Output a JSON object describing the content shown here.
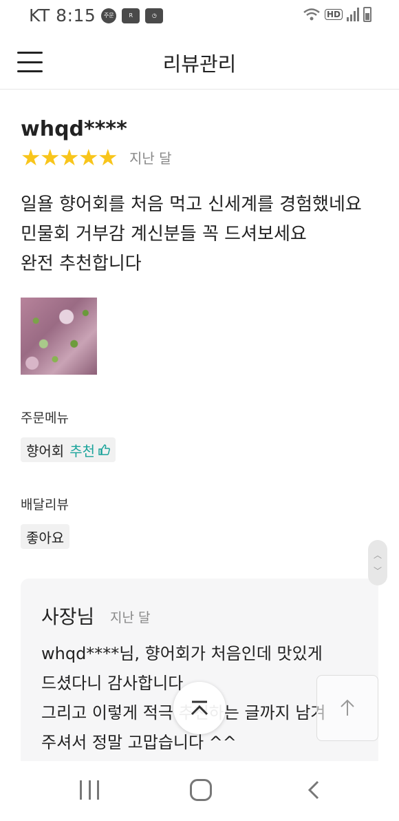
{
  "status_bar": {
    "carrier_time": "KT 8:15",
    "order_badge": "주문",
    "icon_r": "R",
    "hd_label": "HD"
  },
  "header": {
    "title": "리뷰관리"
  },
  "review": {
    "author": "whqd****",
    "rating": 5,
    "stars": "★★★★★",
    "date": "지난 달",
    "lines": [
      "일욜 향어회를 처음 먹고 신세계를 경험했네요",
      "민물회 거부감 계신분들 꼭 드셔보세요",
      "완전 추천합니다"
    ]
  },
  "order_menu": {
    "label": "주문메뉴",
    "item": "향어회",
    "recommend": "추천"
  },
  "delivery_review": {
    "label": "배달리뷰",
    "value": "좋아요"
  },
  "owner_reply": {
    "name": "사장님",
    "date": "지난 달",
    "lines": [
      "whqd****님, 향어회가 처음인데 맛있게",
      "드셨다니 감사합니다",
      "그리고 이렇게 적극 추천하는 글까지 남겨",
      "주셔서 정말 고맙습니다 ^^"
    ]
  },
  "icons": {
    "menu": "hamburger-icon",
    "thumb": "thumbs-up-icon",
    "scroll_top": "chevron-up-icon",
    "arrow_up": "arrow-up-icon"
  },
  "colors": {
    "star": "#f8c51b",
    "recommend": "#1aa39a",
    "reply_bg": "#f6f6f7"
  }
}
